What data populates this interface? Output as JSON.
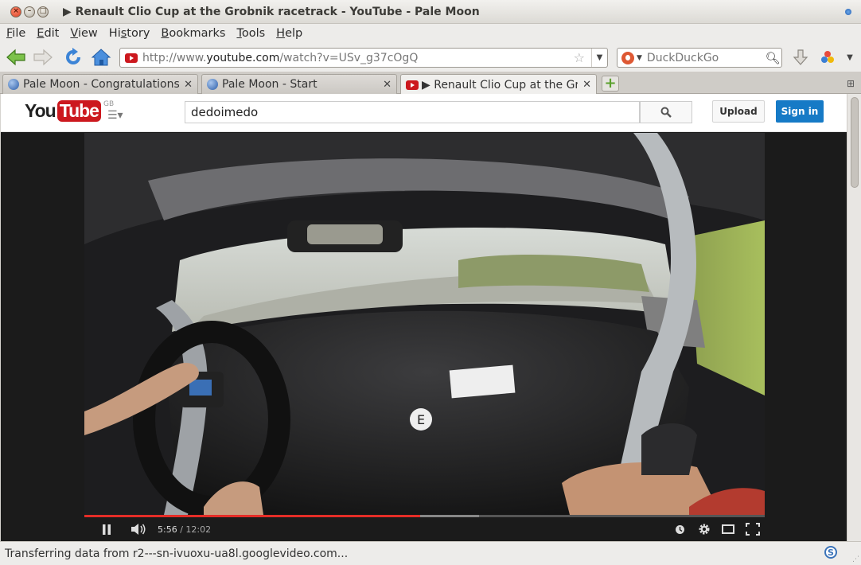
{
  "window": {
    "title": "▶ Renault Clio Cup at the Grobnik racetrack - YouTube - Pale Moon"
  },
  "menu": {
    "items": [
      {
        "label": "File",
        "access": "F"
      },
      {
        "label": "Edit",
        "access": "E"
      },
      {
        "label": "View",
        "access": "V"
      },
      {
        "label": "History",
        "access": "s"
      },
      {
        "label": "Bookmarks",
        "access": "B"
      },
      {
        "label": "Tools",
        "access": "T"
      },
      {
        "label": "Help",
        "access": "H"
      }
    ]
  },
  "navbar": {
    "url_prefix": "http://www.",
    "url_domain": "youtube.com",
    "url_path": "/watch?v=USv_g37cOgQ",
    "search_placeholder": "DuckDuckGo"
  },
  "tabs": [
    {
      "label": "Pale Moon - Congratulations",
      "active": false
    },
    {
      "label": "Pale Moon - Start",
      "active": false
    },
    {
      "label": "▶ Renault Clio Cup at the Gr...",
      "active": true
    }
  ],
  "youtube": {
    "logo_you": "You",
    "logo_tube": "Tube",
    "region": "GB",
    "search_value": "dedoimedo",
    "upload_label": "Upload",
    "signin_label": "Sign in"
  },
  "player": {
    "current_time": "5:56",
    "separator": " / ",
    "duration": "12:02",
    "played_fraction": 0.493,
    "buffered_fraction": 0.58
  },
  "status": {
    "text": "Transferring data from r2---sn-ivuoxu-ua8l.googlevideo.com..."
  },
  "colors": {
    "youtube_red": "#cc181e",
    "progress_red": "#e52d27",
    "signin_blue": "#167ac6"
  }
}
